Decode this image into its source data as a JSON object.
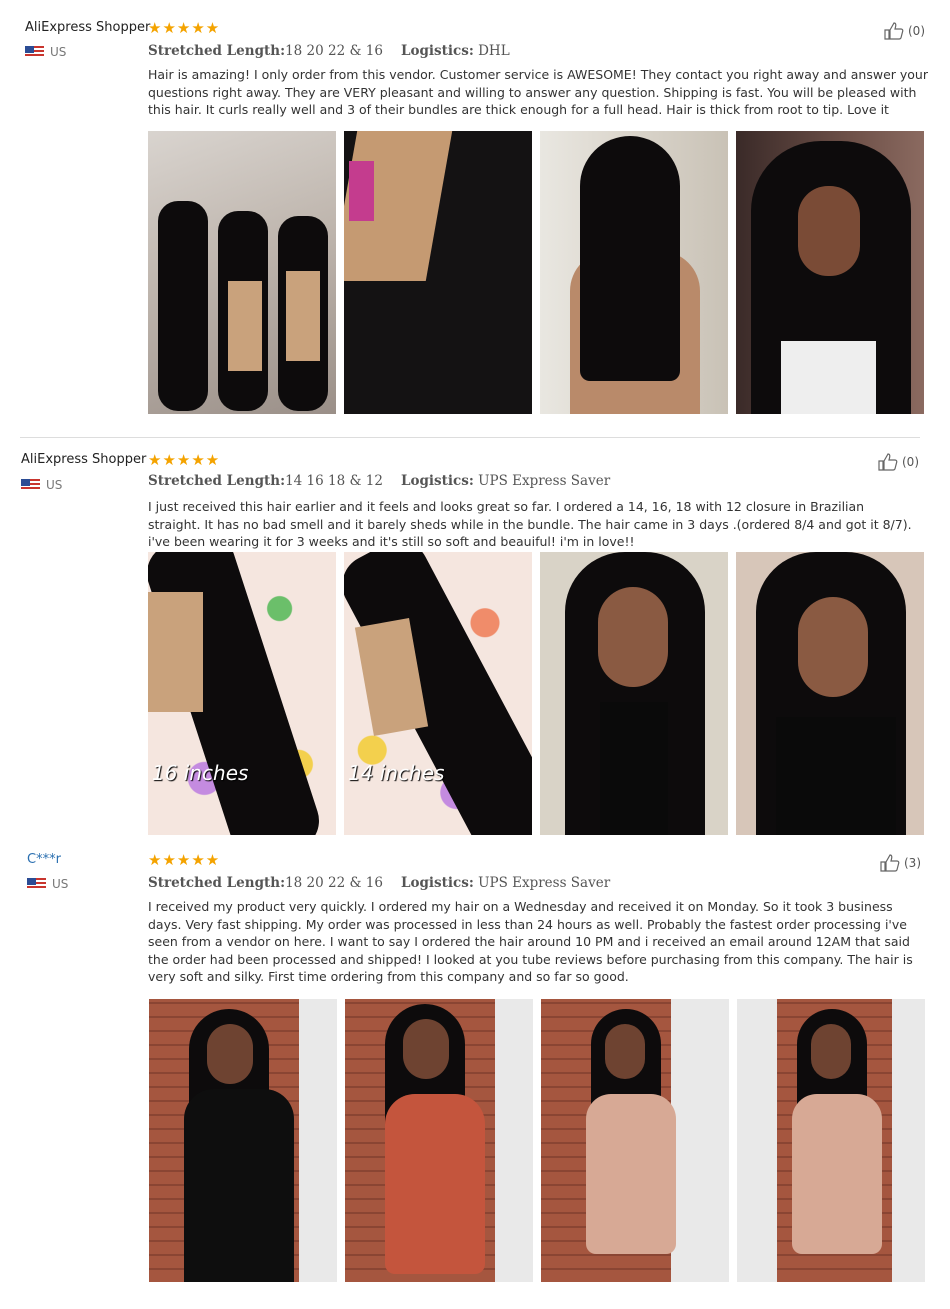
{
  "reviews": [
    {
      "name": "AliExpress Shopper",
      "country": "US",
      "stars": "★★★★★",
      "helpful": "(0)",
      "length_label": "Stretched Length:",
      "length_value": "18 20 22 & 16",
      "logistics_label": "Logistics:",
      "logistics_value": "DHL",
      "text": "Hair is amazing! I only order from this vendor. Customer service is AWESOME! They contact you right away and answer your questions right away. They are VERY pleasant and willing to answer any question. Shipping is fast. You will be pleased with this hair. It curls really well and 3 of their bundles are thick enough for a full head. Hair is thick from root to tip. Love it",
      "photos": [
        "",
        "",
        "",
        ""
      ]
    },
    {
      "name": "AliExpress Shopper",
      "country": "US",
      "stars": "★★★★★",
      "helpful": "(0)",
      "length_label": "Stretched Length:",
      "length_value": "14 16 18 & 12",
      "logistics_label": "Logistics:",
      "logistics_value": "UPS Express Saver",
      "text": "I just received this hair earlier and it feels and looks great so far. I ordered a 14, 16, 18 with 12 closure in Brazilian straight. It has no bad smell and it barely sheds while in the bundle. The hair came in 3 days .(ordered 8/4 and got it 8/7). i've been wearing it for 3 weeks and it's still so soft and beauiful! i'm in love!!",
      "photos": [
        "16 inches",
        "14 inches",
        "",
        ""
      ]
    },
    {
      "name": "C***r",
      "country": "US",
      "stars": "★★★★★",
      "helpful": "(3)",
      "length_label": "Stretched Length:",
      "length_value": "18 20 22 & 16",
      "logistics_label": "Logistics:",
      "logistics_value": "UPS Express Saver",
      "text": "I received my product very quickly. I ordered my hair on a Wednesday and received it on Monday. So it took 3 business days. Very fast shipping. My order was processed in less than 24 hours as well. Probably the fastest order processing i've seen from a vendor on here. I want to say I ordered the hair around 10 PM and i received an email around 12AM that said the order had been processed and shipped! I looked at you tube reviews before purchasing from this company. The hair is very soft and silky. First time ordering from this company and so far so good.",
      "photos": [
        "",
        "",
        "",
        ""
      ]
    }
  ]
}
